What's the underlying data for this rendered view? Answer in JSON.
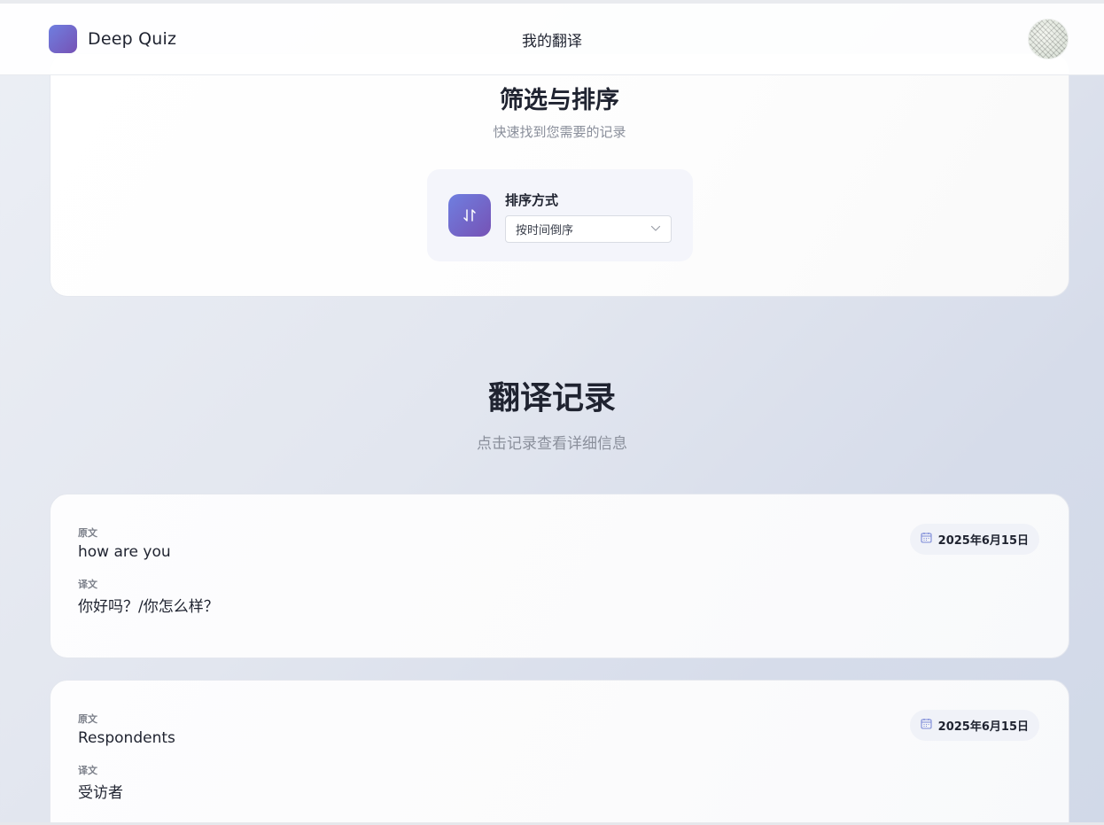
{
  "header": {
    "brand": "Deep Quiz",
    "title": "我的翻译",
    "logo_color_start": "#6f7fe0",
    "logo_color_end": "#7652b5"
  },
  "filter": {
    "title": "筛选与排序",
    "subtitle": "快速找到您需要的记录",
    "sort_label": "排序方式",
    "sort_value": "按时间倒序",
    "sort_icon": "sort-arrows-icon"
  },
  "records": {
    "title": "翻译记录",
    "subtitle": "点击记录查看详细信息",
    "source_label": "原文",
    "target_label": "译文",
    "items": [
      {
        "source": "how are you",
        "target": "你好吗？/你怎么样？",
        "date": "2025年6月15日"
      },
      {
        "source": "Respondents",
        "target": "受访者",
        "date": "2025年6月15日"
      }
    ]
  }
}
